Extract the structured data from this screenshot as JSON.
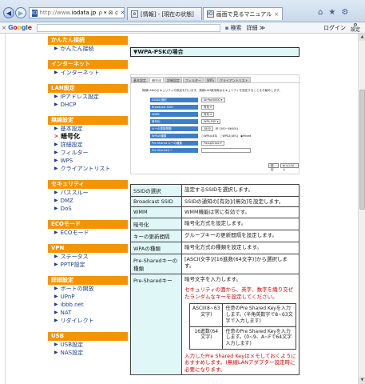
{
  "browser": {
    "url_prefix": "http://www.",
    "url_host": "iodata.jp",
    "addr_tools": "ρ ▾ ⊠ ¢ ✕",
    "tabs": [
      {
        "label": "[情報] - [現在の状態]",
        "active": false
      },
      {
        "label": "画面で見るマニュアル",
        "active": true
      }
    ]
  },
  "toolbar": {
    "close": "×",
    "google": "Google",
    "search_label": "検索",
    "more_label": "詳細 ≫",
    "login_label": "ログイン",
    "settings_label": "設定"
  },
  "sidebar": [
    {
      "header": "かんたん接続",
      "items": [
        {
          "label": "かんたん接続",
          "current": false
        }
      ]
    },
    {
      "header": "インターネット",
      "items": [
        {
          "label": "インターネット",
          "current": false
        }
      ]
    },
    {
      "header": "LAN設定",
      "items": [
        {
          "label": "IPアドレス設定",
          "current": false
        },
        {
          "label": "DHCP",
          "current": false
        }
      ]
    },
    {
      "header": "無線設定",
      "items": [
        {
          "label": "基本設定",
          "current": false
        },
        {
          "label": "暗号化",
          "current": true
        },
        {
          "label": "詳細設定",
          "current": false
        },
        {
          "label": "フィルター",
          "current": false
        },
        {
          "label": "WPS",
          "current": false
        },
        {
          "label": "クライアントリスト",
          "current": false
        }
      ]
    },
    {
      "header": "セキュリティ",
      "items": [
        {
          "label": "パススルー",
          "current": false
        },
        {
          "label": "DMZ",
          "current": false
        },
        {
          "label": "DoS",
          "current": false
        }
      ]
    },
    {
      "header": "ECOモード",
      "items": [
        {
          "label": "ECOモード",
          "current": false
        }
      ]
    },
    {
      "header": "VPN",
      "items": [
        {
          "label": "ステータス",
          "current": false
        },
        {
          "label": "PPTP設定",
          "current": false
        }
      ]
    },
    {
      "header": "詳細設定",
      "items": [
        {
          "label": "ポートの開放",
          "current": false
        },
        {
          "label": "UPnP",
          "current": false
        },
        {
          "label": "ibbb.net",
          "current": false
        },
        {
          "label": "NAT",
          "current": false
        },
        {
          "label": "リダイレクト",
          "current": false
        }
      ]
    },
    {
      "header": "USB",
      "items": [
        {
          "label": "USB設定",
          "current": false
        },
        {
          "label": "NAS設定",
          "current": false
        }
      ]
    }
  ],
  "main": {
    "title": "▼WPA-PSKの場合",
    "screenshot": {
      "tabs": [
        "基本設定",
        "暗号化",
        "詳細設定",
        "フィルター",
        "WPS",
        "クライアントリスト"
      ],
      "active_tab": 1,
      "description": "無線LANのセキュリティの設定を行います。無線LAN使用時はセキュリティを設定することをお勧めします。",
      "fields": [
        {
          "label": "SSIDの選択",
          "value": "AirPort0000 ▾"
        },
        {
          "label": "Broadcast SSID",
          "value": "有効 ▾"
        },
        {
          "label": "WMM",
          "value": "有効 ▾"
        },
        {
          "label": "暗号化",
          "value": "WPA-PSK ▾"
        },
        {
          "label": "キーの更新間隔",
          "value": "1800",
          "extra": "秒 (300~86400)"
        },
        {
          "label": "WPAの種類",
          "radios": [
            "WPA(AES)",
            "WPA2(AES)",
            "Mixed"
          ]
        },
        {
          "label": "Pre-Shared キーの種類",
          "value": "Passphrase ▾"
        },
        {
          "label": "Pre-Sharedキー",
          "value": ""
        }
      ],
      "buttons": [
        "設定",
        "キャンセル"
      ]
    },
    "table": [
      {
        "key": "SSIDの選択",
        "value": "設定するSSIDを選択します。"
      },
      {
        "key": "Broadcast SSID",
        "value": "SSIDの通知の[有効]/[無効]を設定します。"
      },
      {
        "key": "WMM",
        "value": "WMM機能は常に有効です。"
      },
      {
        "key": "暗号化",
        "value": "暗号化方式を設定します。"
      },
      {
        "key": "キーの更新間隔",
        "value": "グループキーの更新間隔を設定します。"
      },
      {
        "key": "WPAの種類",
        "value": "暗号化方式の種類を設定します。"
      },
      {
        "key": "Pre-Sharedキーの種類",
        "value": "[ASCII文字]/[16進数(64文字)]から選択します。"
      }
    ],
    "psk": {
      "key": "Pre-Sharedキー",
      "intro": "暗号文字を入力します。",
      "warning": "セキュリティの面から、英字、数字を織り交ぜたランダムなキーを設定してください。",
      "rows": [
        {
          "type": "ASCII(8~63文字)",
          "desc": "任意のPre Shared Keyを入力します。(半角英数字で8~63文字で入力します)"
        },
        {
          "type": "16進数(64文字)",
          "desc": "任意のPre Shared Keyを入力します。(0~9、A~Fで64文字入力します)"
        }
      ],
      "note": "入力したPre Shared Keyはメモしておくようにおすすめします。(無線LANアダプター設定時に必要になります。"
    }
  }
}
